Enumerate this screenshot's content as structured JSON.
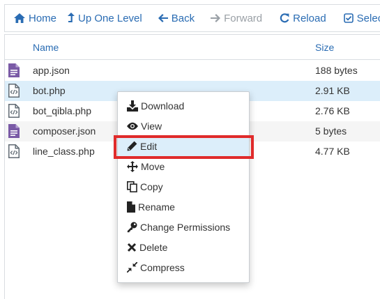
{
  "toolbar": {
    "home": "Home",
    "up_one_level": "Up One Level",
    "back": "Back",
    "forward": "Forward",
    "reload": "Reload",
    "select": "Select"
  },
  "table": {
    "columns": {
      "name": "Name",
      "size": "Size"
    },
    "rows": [
      {
        "name": "app.json",
        "size": "188 bytes",
        "icon": "file-text-icon"
      },
      {
        "name": "bot.php",
        "size": "2.91 KB",
        "icon": "file-code-icon"
      },
      {
        "name": "bot_qibla.php",
        "size": "2.76 KB",
        "icon": "file-code-icon"
      },
      {
        "name": "composer.json",
        "size": "5 bytes",
        "icon": "file-text-icon"
      },
      {
        "name": "line_class.php",
        "size": "4.77 KB",
        "icon": "file-code-icon"
      }
    ]
  },
  "context_menu": {
    "items": [
      {
        "label": "Download",
        "icon": "download-icon"
      },
      {
        "label": "View",
        "icon": "eye-icon"
      },
      {
        "label": "Edit",
        "icon": "pencil-icon"
      },
      {
        "label": "Move",
        "icon": "move-icon"
      },
      {
        "label": "Copy",
        "icon": "copy-icon"
      },
      {
        "label": "Rename",
        "icon": "file-icon"
      },
      {
        "label": "Change Permissions",
        "icon": "key-icon"
      },
      {
        "label": "Delete",
        "icon": "close-icon"
      },
      {
        "label": "Compress",
        "icon": "compress-icon"
      }
    ]
  },
  "colors": {
    "link": "#2a6cb3",
    "disabled": "#9aa0a6",
    "selected_row": "#dceefa",
    "highlight_border": "#e02b2b",
    "file_text_icon": "#7a5aa6",
    "file_code_icon": "#606a73"
  }
}
